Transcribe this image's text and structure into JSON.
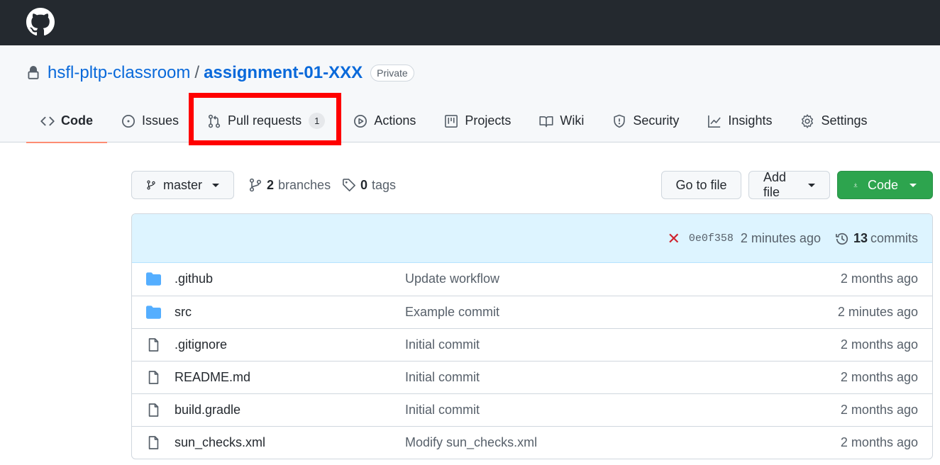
{
  "topbar": {
    "logo_icon": "github-mark-icon"
  },
  "repo": {
    "owner": "hsfl-pltp-classroom",
    "separator": "/",
    "name": "assignment-01-XXX",
    "visibility": "Private"
  },
  "tabs": [
    {
      "label": "Code",
      "icon": "code-icon",
      "active": true
    },
    {
      "label": "Issues",
      "icon": "issue-opened-icon"
    },
    {
      "label": "Pull requests",
      "icon": "git-pull-request-icon",
      "count": "1"
    },
    {
      "label": "Actions",
      "icon": "play-icon"
    },
    {
      "label": "Projects",
      "icon": "table-icon"
    },
    {
      "label": "Wiki",
      "icon": "book-icon"
    },
    {
      "label": "Security",
      "icon": "shield-icon"
    },
    {
      "label": "Insights",
      "icon": "graph-icon"
    },
    {
      "label": "Settings",
      "icon": "gear-icon"
    }
  ],
  "toolbar": {
    "branch": "master",
    "branches_count": "2",
    "branches_label": "branches",
    "tags_count": "0",
    "tags_label": "tags",
    "go_to_file": "Go to file",
    "add_file": "Add file",
    "code": "Code"
  },
  "latest_commit": {
    "status": "failed",
    "sha": "0e0f358",
    "time": "2 minutes ago",
    "commits_count": "13",
    "commits_label": "commits"
  },
  "files": [
    {
      "type": "dir",
      "name": ".github",
      "message": "Update workflow",
      "age": "2 months ago"
    },
    {
      "type": "dir",
      "name": "src",
      "message": "Example commit",
      "age": "2 minutes ago"
    },
    {
      "type": "file",
      "name": ".gitignore",
      "message": "Initial commit",
      "age": "2 months ago"
    },
    {
      "type": "file",
      "name": "README.md",
      "message": "Initial commit",
      "age": "2 months ago"
    },
    {
      "type": "file",
      "name": "build.gradle",
      "message": "Initial commit",
      "age": "2 months ago"
    },
    {
      "type": "file",
      "name": "sun_checks.xml",
      "message": "Modify sun_checks.xml",
      "age": "2 months ago"
    }
  ],
  "colors": {
    "header_bg": "#24292f",
    "link": "#0969da",
    "active_tab_underline": "#fd8c73",
    "primary_button": "#2da44e",
    "commit_bar_bg": "#ddf4ff",
    "fail": "#cf222e",
    "folder": "#54aeff",
    "highlight": "#ff0000"
  }
}
